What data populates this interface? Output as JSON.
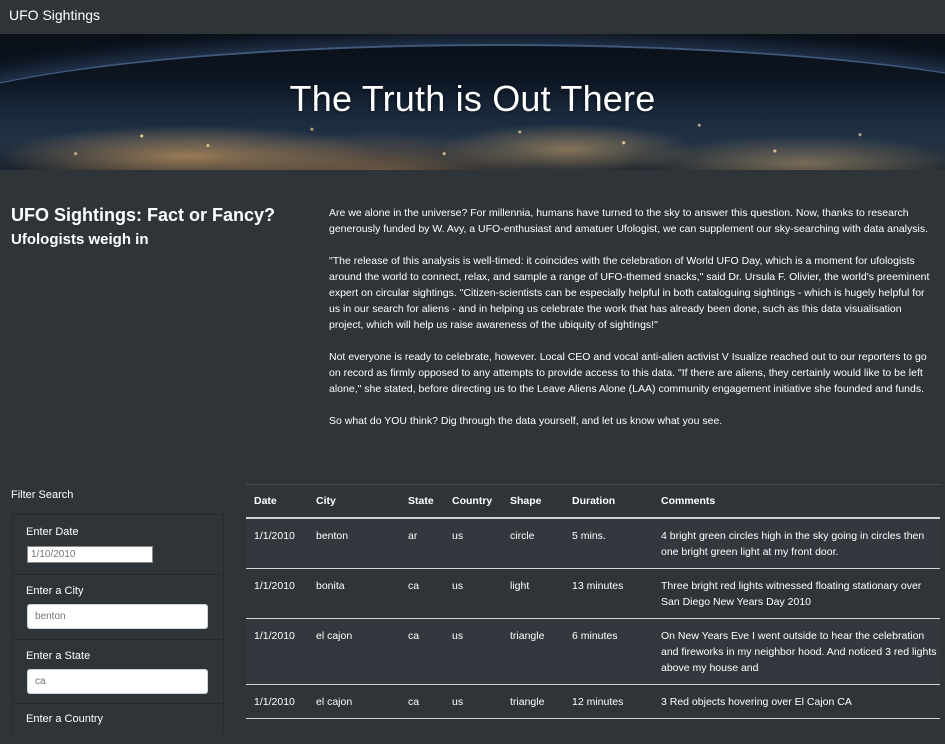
{
  "navbar": {
    "brand": "UFO Sightings"
  },
  "hero": {
    "title": "The Truth is Out There"
  },
  "intro": {
    "title": "UFO Sightings: Fact or Fancy?",
    "subtitle": "Ufologists weigh in"
  },
  "article": {
    "paragraphs": [
      "Are we alone in the universe? For millennia, humans have turned to the sky to answer this question. Now, thanks to research generously funded by W. Avy, a UFO-enthusiast and amatuer Ufologist, we can supplement our sky-searching with data analysis.",
      "\"The release of this analysis is well-timed: it coincides with the celebration of World UFO Day, which is a moment for ufologists around the world to connect, relax, and sample a range of UFO-themed snacks,\" said Dr. Ursula F. Olivier, the world's preeminent expert on circular sightings. \"Citizen-scientists can be especially helpful in both cataloguing sightings - which is hugely helpful for us in our search for aliens - and in helping us celebrate the work that has already been done, such as this data visualisation project, which will help us raise awareness of the ubiquity of sightings!\"",
      "Not everyone is ready to celebrate, however. Local CEO and vocal anti-alien activist V Isualize reached out to our reporters to go on record as firmly opposed to any attempts to provide access to this data. \"If there are aliens, they certainly would like to be left alone,\" she stated, before directing us to the Leave Aliens Alone (LAA) community engagement initiative she founded and funds.",
      "So what do YOU think? Dig through the data yourself, and let us know what you see."
    ]
  },
  "filters": {
    "title": "Filter Search",
    "date": {
      "label": "Enter Date",
      "placeholder": "1/10/2010"
    },
    "city": {
      "label": "Enter a City",
      "placeholder": "benton"
    },
    "state": {
      "label": "Enter a State",
      "placeholder": "ca"
    },
    "country": {
      "label": "Enter a Country"
    }
  },
  "table": {
    "headers": [
      "Date",
      "City",
      "State",
      "Country",
      "Shape",
      "Duration",
      "Comments"
    ],
    "rows": [
      [
        "1/1/2010",
        "benton",
        "ar",
        "us",
        "circle",
        "5 mins.",
        "4 bright green circles high in the sky going in circles then one bright green light at my front door."
      ],
      [
        "1/1/2010",
        "bonita",
        "ca",
        "us",
        "light",
        "13 minutes",
        "Three bright red lights witnessed floating stationary over San Diego New Years Day 2010"
      ],
      [
        "1/1/2010",
        "el cajon",
        "ca",
        "us",
        "triangle",
        "6 minutes",
        "On New Years Eve I went outside to hear the celebration and fireworks in my neighbor hood. And noticed 3 red lights above my house and"
      ],
      [
        "1/1/2010",
        "el cajon",
        "ca",
        "us",
        "triangle",
        "12 minutes",
        "3 Red objects hovering over El Cajon CA"
      ]
    ]
  }
}
